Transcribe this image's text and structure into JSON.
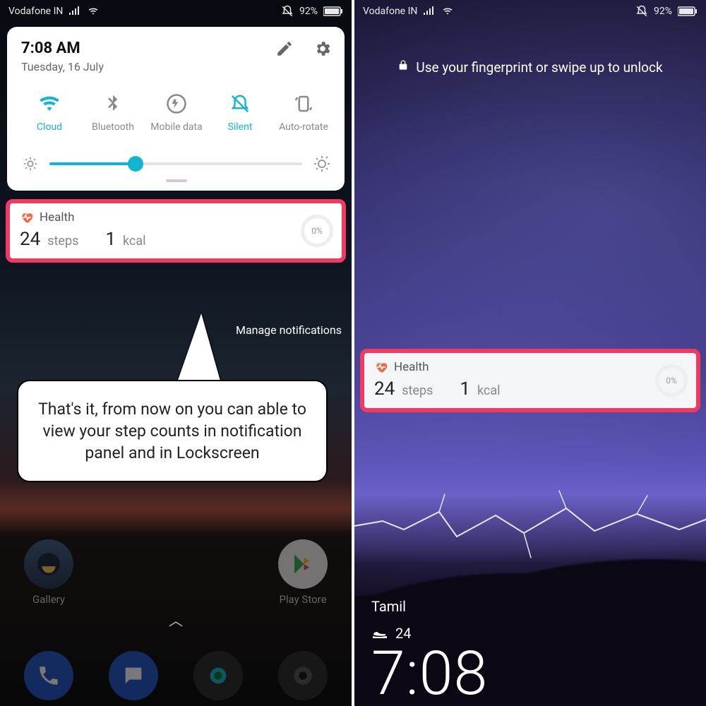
{
  "statusbar": {
    "carrier": "Vodafone IN",
    "battery": "92%"
  },
  "left": {
    "qs": {
      "time": "7:08 AM",
      "date": "Tuesday, 16 July",
      "toggles": {
        "wifi": "Cloud",
        "bt": "Bluetooth",
        "data": "Mobile data",
        "silent": "Silent",
        "rotate": "Auto-rotate"
      }
    },
    "health": {
      "title": "Health",
      "steps_value": "24",
      "steps_unit": "steps",
      "kcal_value": "1",
      "kcal_unit": "kcal",
      "goal_pct": "0%"
    },
    "manage": "Manage notifications",
    "callout": "That's it, from now on you can able to view your step counts in notification panel and in Lockscreen",
    "apps": {
      "gallery": "Gallery",
      "playstore": "Play Store"
    }
  },
  "right": {
    "lock_hint": "Use your fingerprint or swipe up to unlock",
    "health": {
      "title": "Health",
      "steps_value": "24",
      "steps_unit": "steps",
      "kcal_value": "1",
      "kcal_unit": "kcal",
      "goal_pct": "0%"
    },
    "lang": "Tamil",
    "ls_steps": "24",
    "clock": "7:08"
  }
}
